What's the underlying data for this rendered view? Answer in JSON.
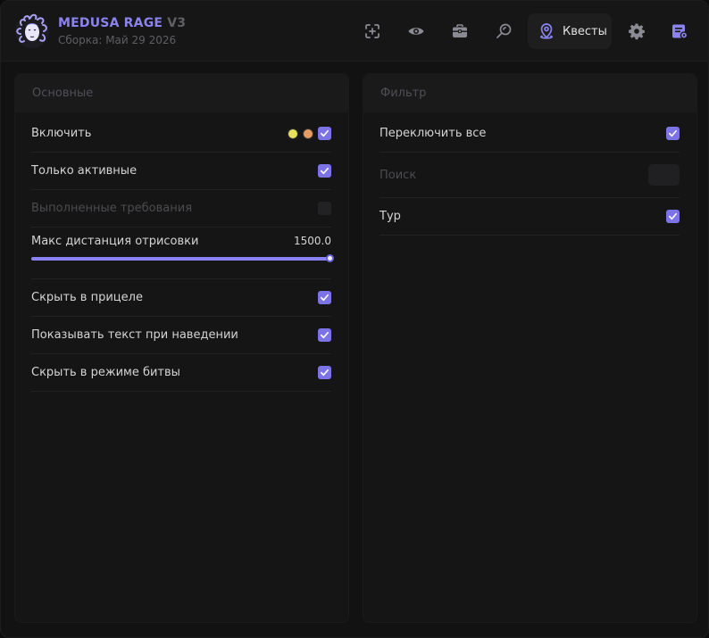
{
  "header": {
    "brand_name": "MEDUSA RAGE",
    "brand_version": "V3",
    "build_text": "Сборка: Май 29 2026"
  },
  "nav": {
    "active_label": "Квесты",
    "icons": [
      "crosshair-icon",
      "eye-icon",
      "briefcase-icon",
      "search-radar-icon",
      "map-pin-icon",
      "gear-icon",
      "script-settings-icon"
    ]
  },
  "left_panel": {
    "title": "Основные",
    "enable": {
      "label": "Включить",
      "checked": true,
      "colors": [
        "#e6e05a",
        "#e89a63"
      ]
    },
    "only_active": {
      "label": "Только активные",
      "checked": true
    },
    "completed_requirements": {
      "label": "Выполненные требования",
      "checked": false,
      "disabled": true
    },
    "max_distance": {
      "label": "Макс дистанция отрисовки",
      "value_text": "1500.0",
      "fraction": 1.0
    },
    "hide_in_scope": {
      "label": "Скрыть в прицеле",
      "checked": true
    },
    "show_text_on_hover": {
      "label": "Показывать текст при наведении",
      "checked": true
    },
    "hide_in_combat": {
      "label": "Скрыть в режиме битвы",
      "checked": true
    }
  },
  "right_panel": {
    "title": "Фильтр",
    "toggle_all": {
      "label": "Переключить все",
      "checked": true
    },
    "search": {
      "label": "Поиск",
      "value": ""
    },
    "tour": {
      "label": "Тур",
      "checked": true
    }
  },
  "colors": {
    "accent": "#7c74e6",
    "background": "#121212",
    "panel": "#151515"
  }
}
